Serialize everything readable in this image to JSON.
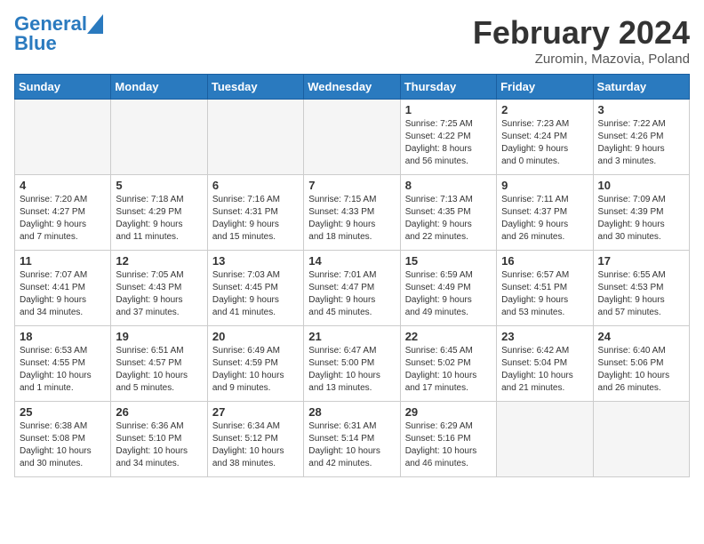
{
  "header": {
    "logo_line1": "General",
    "logo_line2": "Blue",
    "title": "February 2024",
    "subtitle": "Zuromin, Mazovia, Poland"
  },
  "days_of_week": [
    "Sunday",
    "Monday",
    "Tuesday",
    "Wednesday",
    "Thursday",
    "Friday",
    "Saturday"
  ],
  "weeks": [
    [
      {
        "day": "",
        "info": ""
      },
      {
        "day": "",
        "info": ""
      },
      {
        "day": "",
        "info": ""
      },
      {
        "day": "",
        "info": ""
      },
      {
        "day": "1",
        "info": "Sunrise: 7:25 AM\nSunset: 4:22 PM\nDaylight: 8 hours\nand 56 minutes."
      },
      {
        "day": "2",
        "info": "Sunrise: 7:23 AM\nSunset: 4:24 PM\nDaylight: 9 hours\nand 0 minutes."
      },
      {
        "day": "3",
        "info": "Sunrise: 7:22 AM\nSunset: 4:26 PM\nDaylight: 9 hours\nand 3 minutes."
      }
    ],
    [
      {
        "day": "4",
        "info": "Sunrise: 7:20 AM\nSunset: 4:27 PM\nDaylight: 9 hours\nand 7 minutes."
      },
      {
        "day": "5",
        "info": "Sunrise: 7:18 AM\nSunset: 4:29 PM\nDaylight: 9 hours\nand 11 minutes."
      },
      {
        "day": "6",
        "info": "Sunrise: 7:16 AM\nSunset: 4:31 PM\nDaylight: 9 hours\nand 15 minutes."
      },
      {
        "day": "7",
        "info": "Sunrise: 7:15 AM\nSunset: 4:33 PM\nDaylight: 9 hours\nand 18 minutes."
      },
      {
        "day": "8",
        "info": "Sunrise: 7:13 AM\nSunset: 4:35 PM\nDaylight: 9 hours\nand 22 minutes."
      },
      {
        "day": "9",
        "info": "Sunrise: 7:11 AM\nSunset: 4:37 PM\nDaylight: 9 hours\nand 26 minutes."
      },
      {
        "day": "10",
        "info": "Sunrise: 7:09 AM\nSunset: 4:39 PM\nDaylight: 9 hours\nand 30 minutes."
      }
    ],
    [
      {
        "day": "11",
        "info": "Sunrise: 7:07 AM\nSunset: 4:41 PM\nDaylight: 9 hours\nand 34 minutes."
      },
      {
        "day": "12",
        "info": "Sunrise: 7:05 AM\nSunset: 4:43 PM\nDaylight: 9 hours\nand 37 minutes."
      },
      {
        "day": "13",
        "info": "Sunrise: 7:03 AM\nSunset: 4:45 PM\nDaylight: 9 hours\nand 41 minutes."
      },
      {
        "day": "14",
        "info": "Sunrise: 7:01 AM\nSunset: 4:47 PM\nDaylight: 9 hours\nand 45 minutes."
      },
      {
        "day": "15",
        "info": "Sunrise: 6:59 AM\nSunset: 4:49 PM\nDaylight: 9 hours\nand 49 minutes."
      },
      {
        "day": "16",
        "info": "Sunrise: 6:57 AM\nSunset: 4:51 PM\nDaylight: 9 hours\nand 53 minutes."
      },
      {
        "day": "17",
        "info": "Sunrise: 6:55 AM\nSunset: 4:53 PM\nDaylight: 9 hours\nand 57 minutes."
      }
    ],
    [
      {
        "day": "18",
        "info": "Sunrise: 6:53 AM\nSunset: 4:55 PM\nDaylight: 10 hours\nand 1 minute."
      },
      {
        "day": "19",
        "info": "Sunrise: 6:51 AM\nSunset: 4:57 PM\nDaylight: 10 hours\nand 5 minutes."
      },
      {
        "day": "20",
        "info": "Sunrise: 6:49 AM\nSunset: 4:59 PM\nDaylight: 10 hours\nand 9 minutes."
      },
      {
        "day": "21",
        "info": "Sunrise: 6:47 AM\nSunset: 5:00 PM\nDaylight: 10 hours\nand 13 minutes."
      },
      {
        "day": "22",
        "info": "Sunrise: 6:45 AM\nSunset: 5:02 PM\nDaylight: 10 hours\nand 17 minutes."
      },
      {
        "day": "23",
        "info": "Sunrise: 6:42 AM\nSunset: 5:04 PM\nDaylight: 10 hours\nand 21 minutes."
      },
      {
        "day": "24",
        "info": "Sunrise: 6:40 AM\nSunset: 5:06 PM\nDaylight: 10 hours\nand 26 minutes."
      }
    ],
    [
      {
        "day": "25",
        "info": "Sunrise: 6:38 AM\nSunset: 5:08 PM\nDaylight: 10 hours\nand 30 minutes."
      },
      {
        "day": "26",
        "info": "Sunrise: 6:36 AM\nSunset: 5:10 PM\nDaylight: 10 hours\nand 34 minutes."
      },
      {
        "day": "27",
        "info": "Sunrise: 6:34 AM\nSunset: 5:12 PM\nDaylight: 10 hours\nand 38 minutes."
      },
      {
        "day": "28",
        "info": "Sunrise: 6:31 AM\nSunset: 5:14 PM\nDaylight: 10 hours\nand 42 minutes."
      },
      {
        "day": "29",
        "info": "Sunrise: 6:29 AM\nSunset: 5:16 PM\nDaylight: 10 hours\nand 46 minutes."
      },
      {
        "day": "",
        "info": ""
      },
      {
        "day": "",
        "info": ""
      }
    ]
  ]
}
